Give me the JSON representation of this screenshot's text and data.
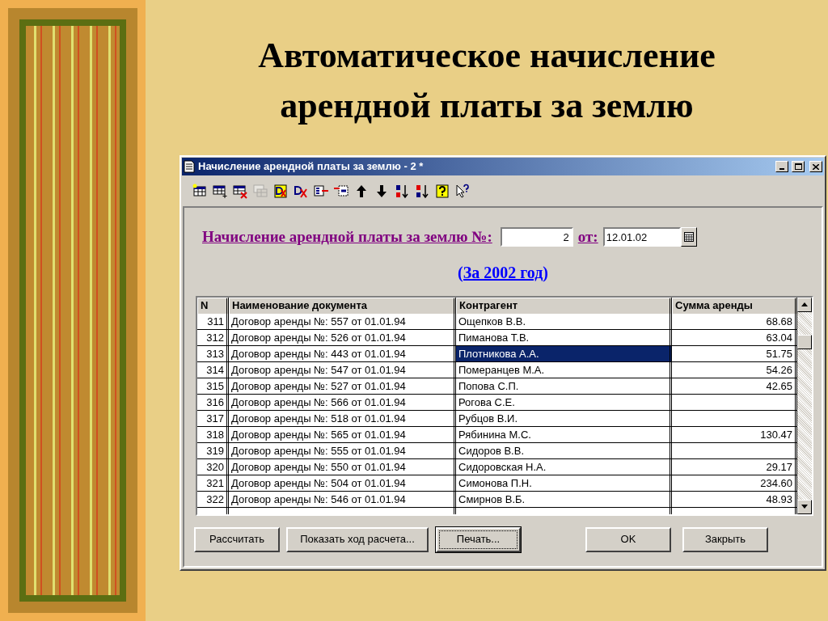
{
  "slide": {
    "title_lines": [
      "Автоматическое начисление",
      "арендной платы за землю"
    ]
  },
  "window": {
    "title": "Начисление арендной платы за землю - 2 *"
  },
  "toolbar": [
    {
      "kind": "new",
      "disabled": false
    },
    {
      "kind": "add",
      "disabled": false
    },
    {
      "kind": "delete",
      "disabled": false
    },
    {
      "kind": "copy",
      "disabled": true
    },
    {
      "kind": "dk",
      "disabled": false
    },
    {
      "kind": "dkx",
      "disabled": false
    },
    {
      "kind": "left",
      "disabled": false
    },
    {
      "kind": "right",
      "disabled": false
    },
    {
      "kind": "up",
      "disabled": false
    },
    {
      "kind": "down",
      "disabled": false
    },
    {
      "kind": "sortaz",
      "disabled": false
    },
    {
      "kind": "sortza",
      "disabled": false
    },
    {
      "kind": "help",
      "disabled": false
    },
    {
      "kind": "pointer",
      "disabled": false
    }
  ],
  "form": {
    "label": "Начисление арендной платы за землю №:",
    "number": "2",
    "date_label": "от:",
    "date": "12.01.02",
    "period": "(За 2002 год)"
  },
  "table": {
    "columns": [
      "N",
      "Наименование документа",
      "Контрагент",
      "Сумма аренды"
    ],
    "rows": [
      {
        "n": "311",
        "doc": "Договор аренды №: 557 от 01.01.94",
        "party": "Ощепков В.В.",
        "sum": "68.68",
        "selected": false
      },
      {
        "n": "312",
        "doc": "Договор аренды №: 526 от 01.01.94",
        "party": "Пиманова Т.В.",
        "sum": "63.04",
        "selected": false
      },
      {
        "n": "313",
        "doc": "Договор аренды №: 443 от 01.01.94",
        "party": "Плотникова А.А.",
        "sum": "51.75",
        "selected": true
      },
      {
        "n": "314",
        "doc": "Договор аренды №: 547 от 01.01.94",
        "party": "Померанцев М.А.",
        "sum": "54.26",
        "selected": false
      },
      {
        "n": "315",
        "doc": "Договор аренды №: 527 от 01.01.94",
        "party": "Попова С.П.",
        "sum": "42.65",
        "selected": false
      },
      {
        "n": "316",
        "doc": "Договор аренды №: 566 от 01.01.94",
        "party": "Рогова С.Е.",
        "selected": false
      },
      {
        "n": "317",
        "doc": "Договор аренды №: 518 от 01.01.94",
        "party": "Рубцов В.И.",
        "selected": false
      },
      {
        "n": "318",
        "doc": "Договор аренды №: 565 от 01.01.94",
        "party": "Рябинина М.С.",
        "sum": "130.47",
        "selected": false
      },
      {
        "n": "319",
        "doc": "Договор аренды №: 555 от 01.01.94",
        "party": "Сидоров В.В.",
        "selected": false
      },
      {
        "n": "320",
        "doc": "Договор аренды №: 550 от 01.01.94",
        "party": "Сидоровская Н.А.",
        "sum": "29.17",
        "selected": false
      },
      {
        "n": "321",
        "doc": "Договор аренды №: 504 от 01.01.94",
        "party": "Симонова П.Н.",
        "sum": "234.60",
        "selected": false
      },
      {
        "n": "322",
        "doc": "Договор аренды №: 546 от 01.01.94",
        "party": "Смирнов В.Б.",
        "sum": "48.93",
        "selected": false
      }
    ]
  },
  "buttons": [
    {
      "label": "Рассчитать",
      "focused": false
    },
    {
      "label": "Показать ход расчета...",
      "focused": false
    },
    {
      "label": "Печать...",
      "focused": true
    },
    {
      "label": "OK",
      "focused": false
    },
    {
      "label": "Закрыть",
      "focused": false
    }
  ]
}
